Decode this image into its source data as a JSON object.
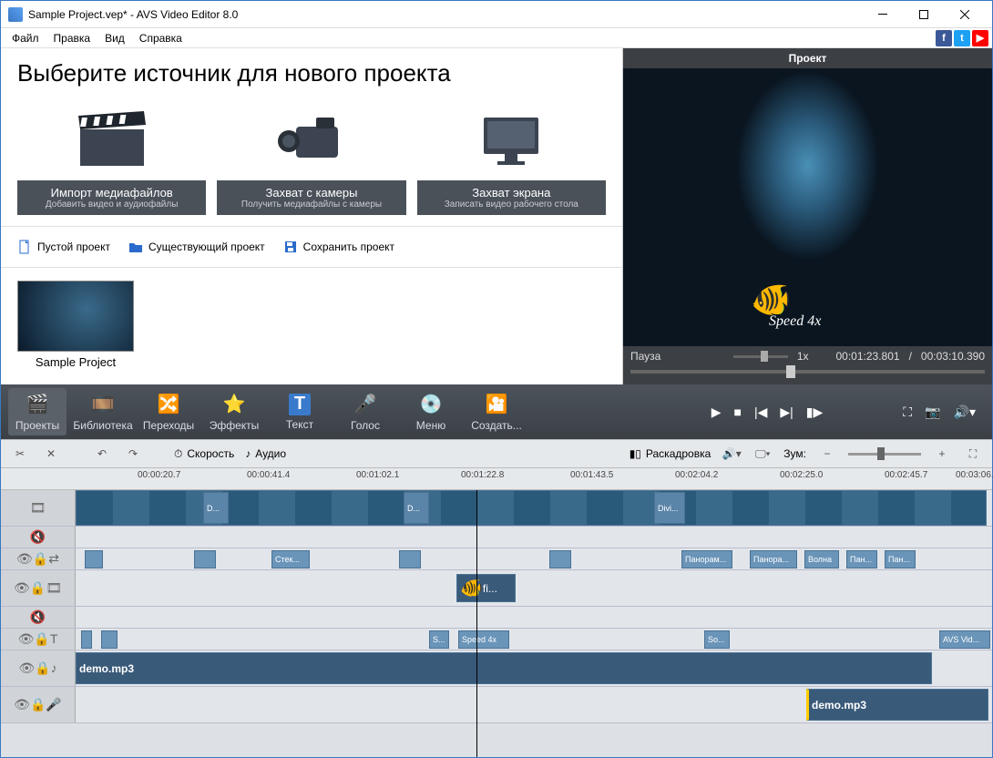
{
  "window": {
    "title": "Sample Project.vep* - AVS Video Editor 8.0"
  },
  "menu": {
    "file": "Файл",
    "edit": "Правка",
    "view": "Вид",
    "help": "Справка"
  },
  "source": {
    "heading": "Выберите источник для нового проекта",
    "cards": [
      {
        "title": "Импорт медиафайлов",
        "sub": "Добавить видео и аудиофайлы"
      },
      {
        "title": "Захват с камеры",
        "sub": "Получить медиафайлы с камеры"
      },
      {
        "title": "Захват экрана",
        "sub": "Записать видео рабочего стола"
      }
    ],
    "empty": "Пустой проект",
    "existing": "Существующий проект",
    "save": "Сохранить проект"
  },
  "thumb": {
    "label": "Sample Project"
  },
  "preview": {
    "title": "Проект",
    "status": "Пауза",
    "speed": "1x",
    "pos": "00:01:23.801",
    "dur": "00:03:10.390",
    "sep": "/",
    "overlay": "Speed 4x"
  },
  "tools": {
    "projects": "Проекты",
    "library": "Библиотека",
    "transitions": "Переходы",
    "effects": "Эффекты",
    "text": "Текст",
    "voice": "Голос",
    "menu": "Меню",
    "produce": "Создать..."
  },
  "tlbar": {
    "speed": "Скорость",
    "audio": "Аудио",
    "storyboard": "Раскадровка",
    "zoom": "Зум:"
  },
  "ruler": [
    "00:00:20.7",
    "00:00:41.4",
    "00:01:02.1",
    "00:01:22.8",
    "00:01:43.5",
    "00:02:04.2",
    "00:02:25.0",
    "00:02:45.7",
    "00:03:06."
  ],
  "clips": {
    "d1": "D...",
    "d2": "D...",
    "divi": "Divi...",
    "glass": "Стек...",
    "fi": "fi...",
    "pan1": "Панорам...",
    "pan2": "Панора...",
    "wave": "Волна",
    "pan3": "Пан...",
    "pan4": "Пан...",
    "s": "S...",
    "speed4x": "Speed 4x",
    "so": "So...",
    "avs": "AVS Vid...",
    "demo1": "demo.mp3",
    "demo2": "demo.mp3"
  }
}
